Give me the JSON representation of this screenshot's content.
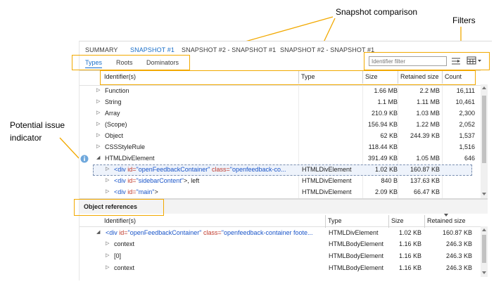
{
  "callouts": {
    "snapshot_comparison": "Snapshot comparison",
    "filters": "Filters",
    "potential_issue_line1": "Potential issue",
    "potential_issue_line2": "indicator"
  },
  "tabs": [
    {
      "label": "SUMMARY",
      "active": false
    },
    {
      "label": "SNAPSHOT #1",
      "active": true
    },
    {
      "label": "SNAPSHOT #2 - SNAPSHOT #1",
      "active": false
    },
    {
      "label": "SNAPSHOT #2 - SNAPSHOT #1",
      "active": false
    }
  ],
  "subtabs": [
    {
      "label": "Types",
      "active": true
    },
    {
      "label": "Roots",
      "active": false
    },
    {
      "label": "Dominators",
      "active": false
    }
  ],
  "filter": {
    "placeholder": "Identifier filter"
  },
  "columns": {
    "identifier": "Identifier(s)",
    "type": "Type",
    "size": "Size",
    "retained": "Retained size",
    "count": "Count"
  },
  "rows": [
    {
      "id": "Function",
      "type": "",
      "size": "1.66 MB",
      "retained": "2.2 MB",
      "count": "16,111",
      "expanded": false
    },
    {
      "id": "String",
      "type": "",
      "size": "1.1 MB",
      "retained": "1.11 MB",
      "count": "10,461",
      "expanded": false
    },
    {
      "id": "Array",
      "type": "",
      "size": "210.9 KB",
      "retained": "1.03 MB",
      "count": "2,300",
      "expanded": false
    },
    {
      "id": "(Scope)",
      "type": "",
      "size": "156.94 KB",
      "retained": "1.22 MB",
      "count": "2,052",
      "expanded": false
    },
    {
      "id": "Object",
      "type": "",
      "size": "62 KB",
      "retained": "244.39 KB",
      "count": "1,537",
      "expanded": false
    },
    {
      "id": "CSSStyleRule",
      "type": "",
      "size": "118.44 KB",
      "retained": "",
      "count": "1,516",
      "expanded": false
    },
    {
      "id": "HTMLDivElement",
      "type": "",
      "size": "391.49 KB",
      "retained": "1.05 MB",
      "count": "646",
      "expanded": true
    }
  ],
  "child_rows": [
    {
      "tag_open": "<div ",
      "a1": "id=",
      "v1": "\"openFeedbackContainer\"",
      "a2": " class=",
      "v2": "\"openfeedback-co...",
      "rest": "",
      "type": "HTMLDivElement",
      "size": "1.02 KB",
      "retained": "160.87 KB"
    },
    {
      "tag_open": "<div ",
      "a1": "id=",
      "v1": "\"sidebarContent\"",
      "a2": "",
      "v2": "",
      "rest": ">, left",
      "type": "HTMLDivElement",
      "size": "840 B",
      "retained": "137.63 KB"
    },
    {
      "tag_open": "<div ",
      "a1": "id=",
      "v1": "\"main\"",
      "a2": "",
      "v2": "",
      "rest": ">",
      "type": "HTMLDivElement",
      "size": "2.09 KB",
      "retained": "66.47 KB"
    }
  ],
  "refs": {
    "title": "Object references",
    "columns": {
      "identifier": "Identifier(s)",
      "type": "Type",
      "size": "Size",
      "retained": "Retained size"
    },
    "root": {
      "tag_open": "<div ",
      "a1": "id=",
      "v1": "\"openFeedbackContainer\"",
      "a2": " class=",
      "v2": "\"openfeedback-container foote...",
      "type": "HTMLDivElement",
      "size": "1.02 KB",
      "retained": "160.87 KB"
    },
    "rows": [
      {
        "id": "context",
        "type": "HTMLBodyElement",
        "size": "1.16 KB",
        "retained": "246.3 KB"
      },
      {
        "id": "[0]",
        "type": "HTMLBodyElement",
        "size": "1.16 KB",
        "retained": "246.3 KB"
      },
      {
        "id": "context",
        "type": "HTMLBodyElement",
        "size": "1.16 KB",
        "retained": "246.3 KB"
      }
    ]
  },
  "icons": {
    "issue": "info-icon",
    "settings": "filter-settings-icon",
    "columns": "column-chooser-icon"
  },
  "colors": {
    "accent": "#1a6fc9",
    "callout_border": "#f2a900",
    "issue": "#6fa8dc"
  }
}
